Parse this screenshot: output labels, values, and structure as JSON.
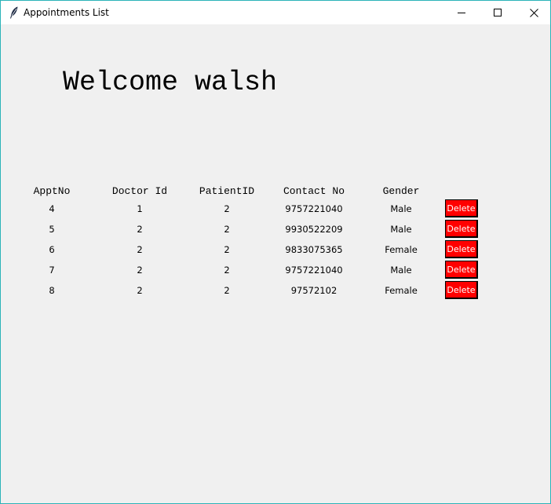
{
  "window": {
    "title": "Appointments List",
    "controls": {
      "minimize": "minimize-icon",
      "maximize": "maximize-icon",
      "close": "close-icon"
    }
  },
  "welcome_text": "Welcome walsh",
  "table": {
    "headers": [
      "ApptNo",
      "Doctor Id",
      "PatientID",
      "Contact No",
      "Gender"
    ],
    "rows": [
      {
        "appt_no": "4",
        "doctor_id": "1",
        "patient_id": "2",
        "contact_no": "9757221040",
        "gender": "Male",
        "action": "Delete"
      },
      {
        "appt_no": "5",
        "doctor_id": "2",
        "patient_id": "2",
        "contact_no": "9930522209",
        "gender": "Male",
        "action": "Delete"
      },
      {
        "appt_no": "6",
        "doctor_id": "2",
        "patient_id": "2",
        "contact_no": "9833075365",
        "gender": "Female",
        "action": "Delete"
      },
      {
        "appt_no": "7",
        "doctor_id": "2",
        "patient_id": "2",
        "contact_no": "9757221040",
        "gender": "Male",
        "action": "Delete"
      },
      {
        "appt_no": "8",
        "doctor_id": "2",
        "patient_id": "2",
        "contact_no": "97572102",
        "gender": "Female",
        "action": "Delete"
      }
    ]
  },
  "colors": {
    "delete_button_bg": "#ff0000",
    "delete_button_text": "#ffffff",
    "window_bg": "#f0f0f0",
    "window_border": "#2bb3b8"
  }
}
